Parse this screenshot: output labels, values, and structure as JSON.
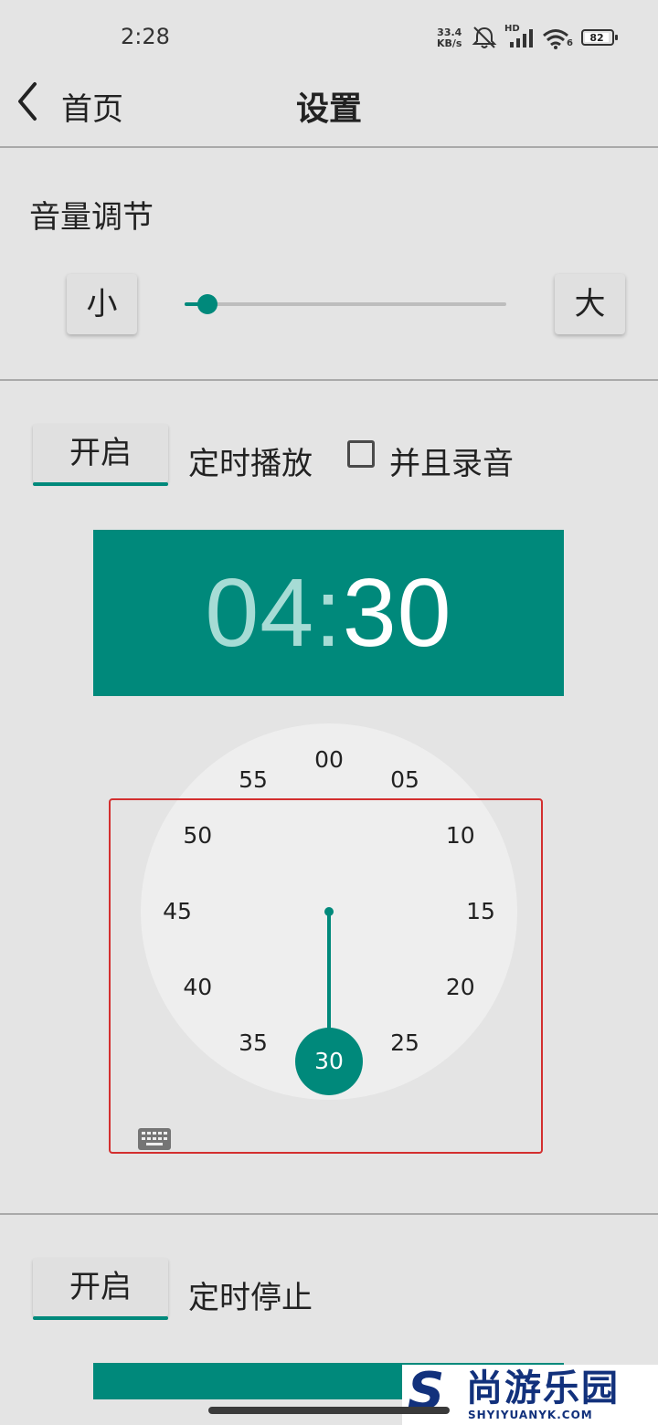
{
  "status_bar": {
    "time": "2:28",
    "net_speed_value": "33.4",
    "net_speed_unit": "KB/s",
    "signal_label": "HD",
    "wifi_badge": "6",
    "battery_level": "82",
    "icons": [
      "mute-notification-icon",
      "signal-bars-icon",
      "wifi-icon",
      "battery-icon"
    ]
  },
  "header": {
    "back_label": "首页",
    "title": "设置"
  },
  "volume": {
    "title": "音量调节",
    "decrease_label": "小",
    "increase_label": "大",
    "level": 0.07
  },
  "timed_play": {
    "toggle_label": "开启",
    "label": "定时播放",
    "record_checked": false,
    "record_label": "并且录音",
    "hour": "04",
    "separator": ":",
    "minute": "30"
  },
  "clock": {
    "numbers": [
      "00",
      "05",
      "10",
      "15",
      "20",
      "25",
      "30",
      "35",
      "40",
      "45",
      "50",
      "55"
    ],
    "selected": "30"
  },
  "timed_stop": {
    "toggle_label": "开启",
    "label": "定时停止"
  },
  "watermark": {
    "logo": "S",
    "name": "尚游乐园",
    "url": "SHYIYUANYK.COM"
  },
  "colors": {
    "accent": "#00897b",
    "highlight": "#d32f2f",
    "background": "#e4e4e4"
  }
}
